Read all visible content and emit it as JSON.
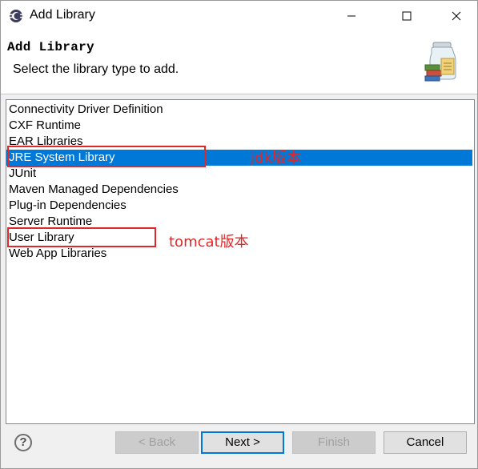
{
  "window": {
    "title": "Add Library"
  },
  "banner": {
    "title": "Add Library",
    "subtitle": "Select the library type to add."
  },
  "library_types": [
    {
      "label": "Connectivity Driver Definition"
    },
    {
      "label": "CXF Runtime"
    },
    {
      "label": "EAR Libraries"
    },
    {
      "label": "JRE System Library",
      "selected": true
    },
    {
      "label": "JUnit"
    },
    {
      "label": "Maven Managed Dependencies"
    },
    {
      "label": "Plug-in Dependencies"
    },
    {
      "label": "Server Runtime"
    },
    {
      "label": "User Library"
    },
    {
      "label": "Web App Libraries"
    }
  ],
  "annotations": {
    "jre_note": "jdk版本",
    "user_note": "tomcat版本"
  },
  "buttons": {
    "back": "< Back",
    "next": "Next >",
    "finish": "Finish",
    "cancel": "Cancel"
  },
  "colors": {
    "selection": "#0078d7",
    "annotation": "#e02828"
  }
}
